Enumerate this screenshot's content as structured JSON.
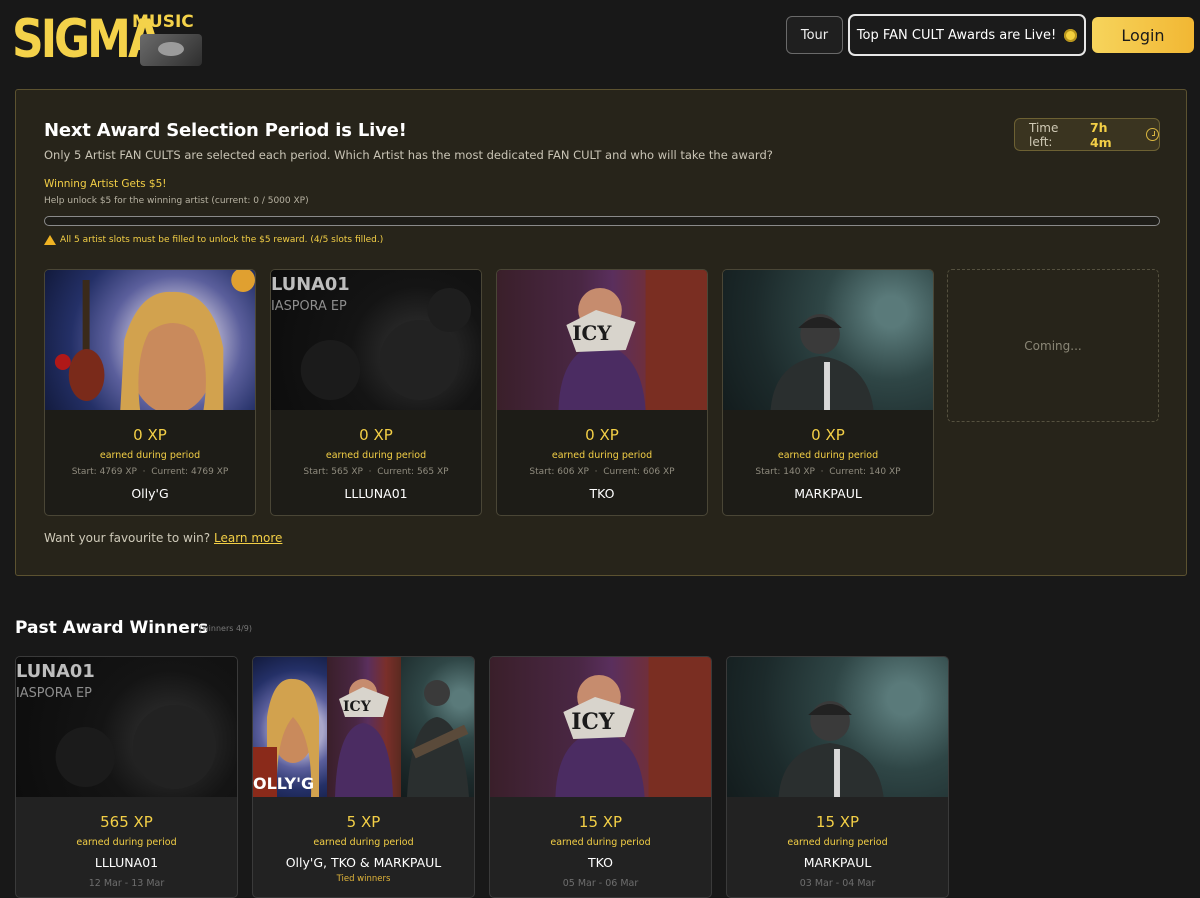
{
  "header": {
    "logo_main": "SIGMA",
    "logo_sub": "MUSIC",
    "tour_label": "Tour",
    "awards_label": "Top FAN CULT Awards are Live!",
    "login_label": "Login"
  },
  "panel": {
    "title": "Next Award Selection Period is Live!",
    "subtitle": "Only 5 Artist FAN CULTS are selected each period. Which Artist has the most dedicated FAN CULT and who will take the award?",
    "timer_label": "Time left:",
    "timer_value": "7h 4m",
    "winning_title": "Winning Artist Gets $5!",
    "winning_help": "Help unlock $5 for the winning artist (current: 0 / 5000 XP)",
    "progress_fraction": 0,
    "warning": "All 5 artist slots must be filled to unlock the $5 reward. (4/5 slots filled.)",
    "learn_prefix": "Want your favourite to win?",
    "learn_link": "Learn more",
    "coming_label": "Coming...",
    "cards": [
      {
        "xp": "0 XP",
        "earned": "earned during period",
        "start": "Start: 4769 XP",
        "current": "Current: 4769 XP",
        "name": "Olly'G"
      },
      {
        "xp": "0 XP",
        "earned": "earned during period",
        "start": "Start: 565 XP",
        "current": "Current: 565 XP",
        "name": "LLLUNA01"
      },
      {
        "xp": "0 XP",
        "earned": "earned during period",
        "start": "Start: 606 XP",
        "current": "Current: 606 XP",
        "name": "TKO"
      },
      {
        "xp": "0 XP",
        "earned": "earned during period",
        "start": "Start: 140 XP",
        "current": "Current: 140 XP",
        "name": "MARKPAUL"
      }
    ]
  },
  "past": {
    "title": "Past Award Winners",
    "count": "(winners 4/9)",
    "cards": [
      {
        "xp": "565 XP",
        "earned": "earned during period",
        "name": "LLLUNA01",
        "date": "12 Mar - 13 Mar"
      },
      {
        "xp": "5 XP",
        "earned": "earned during period",
        "name": "Olly'G, TKO & MARKPAUL",
        "tied": "Tied winners"
      },
      {
        "xp": "15 XP",
        "earned": "earned during period",
        "name": "TKO",
        "date": "05 Mar - 06 Mar"
      },
      {
        "xp": "15 XP",
        "earned": "earned during period",
        "name": "MARKPAUL",
        "date": "03 Mar - 04 Mar"
      }
    ]
  },
  "art_text": {
    "luna_line1": "LUNA01",
    "luna_line2": "IASPORA EP",
    "icy": "ICY",
    "olly_sig": "OLLY'G"
  },
  "colors": {
    "accent": "#f3cf46",
    "panel_bg": "#27241a",
    "page_bg": "#181818"
  }
}
